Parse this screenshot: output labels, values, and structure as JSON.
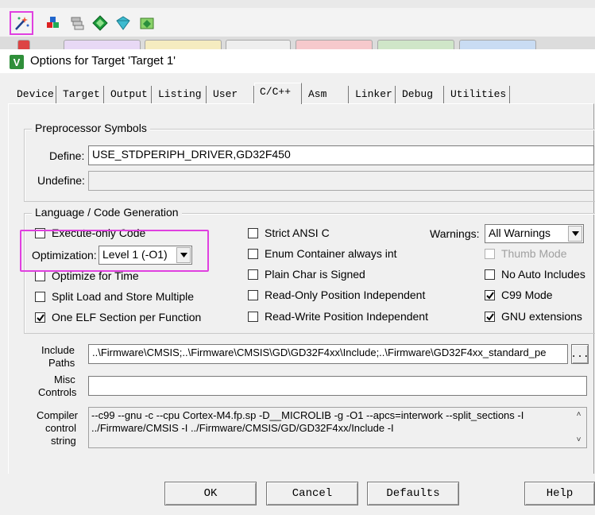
{
  "window": {
    "title": "Options for Target 'Target 1'"
  },
  "tabs": [
    {
      "label": "Device"
    },
    {
      "label": "Target"
    },
    {
      "label": "Output"
    },
    {
      "label": "Listing"
    },
    {
      "label": "User"
    },
    {
      "label": "C/C++"
    },
    {
      "label": "Asm"
    },
    {
      "label": "Linker"
    },
    {
      "label": "Debug"
    },
    {
      "label": "Utilities"
    }
  ],
  "active_tab": "C/C++",
  "preprocessor": {
    "legend": "Preprocessor Symbols",
    "define_label": "Define:",
    "define_value": "USE_STDPERIPH_DRIVER,GD32F450",
    "undefine_label": "Undefine:",
    "undefine_value": ""
  },
  "language": {
    "legend": "Language / Code Generation",
    "execute_only": {
      "label": "Execute-only Code",
      "checked": false
    },
    "optimization_label": "Optimization:",
    "optimization_value": "Level 1 (-O1)",
    "optimize_time": {
      "label": "Optimize for Time",
      "checked": false
    },
    "split_load": {
      "label": "Split Load and Store Multiple",
      "checked": false
    },
    "one_elf": {
      "label": "One ELF Section per Function",
      "checked": true
    },
    "strict_ansi": {
      "label": "Strict ANSI C",
      "checked": false
    },
    "enum_container": {
      "label": "Enum Container always int",
      "checked": false
    },
    "plain_char": {
      "label": "Plain Char is Signed",
      "checked": false
    },
    "ro_pi": {
      "label": "Read-Only Position Independent",
      "checked": false
    },
    "rw_pi": {
      "label": "Read-Write Position Independent",
      "checked": false
    },
    "warnings_label": "Warnings:",
    "warnings_value": "All Warnings",
    "thumb_mode": {
      "label": "Thumb Mode",
      "checked": false,
      "disabled": true
    },
    "no_auto_includes": {
      "label": "No Auto Includes",
      "checked": false
    },
    "c99_mode": {
      "label": "C99 Mode",
      "checked": true
    },
    "gnu_ext": {
      "label": "GNU extensions",
      "checked": true
    }
  },
  "paths": {
    "include_label_1": "Include",
    "include_label_2": "Paths",
    "include_value": "..\\Firmware\\CMSIS;..\\Firmware\\CMSIS\\GD\\GD32F4xx\\Include;..\\Firmware\\GD32F4xx_standard_pe",
    "browse_label": "...",
    "misc_label_1": "Misc",
    "misc_label_2": "Controls",
    "misc_value": "",
    "compiler_label_1": "Compiler",
    "compiler_label_2": "control",
    "compiler_label_3": "string",
    "compiler_line_1": "--c99 --gnu -c --cpu Cortex-M4.fp.sp -D__MICROLIB -g -O1 --apcs=interwork --split_sections -I",
    "compiler_line_2": "../Firmware/CMSIS -I ../Firmware/CMSIS/GD/GD32F4xx/Include -I"
  },
  "buttons": {
    "ok": "OK",
    "cancel": "Cancel",
    "defaults": "Defaults",
    "help": "Help"
  },
  "colors": {
    "highlight": "#e040e0",
    "title_bg": "#ffffff",
    "dialog_bg": "#f0f0f0"
  }
}
